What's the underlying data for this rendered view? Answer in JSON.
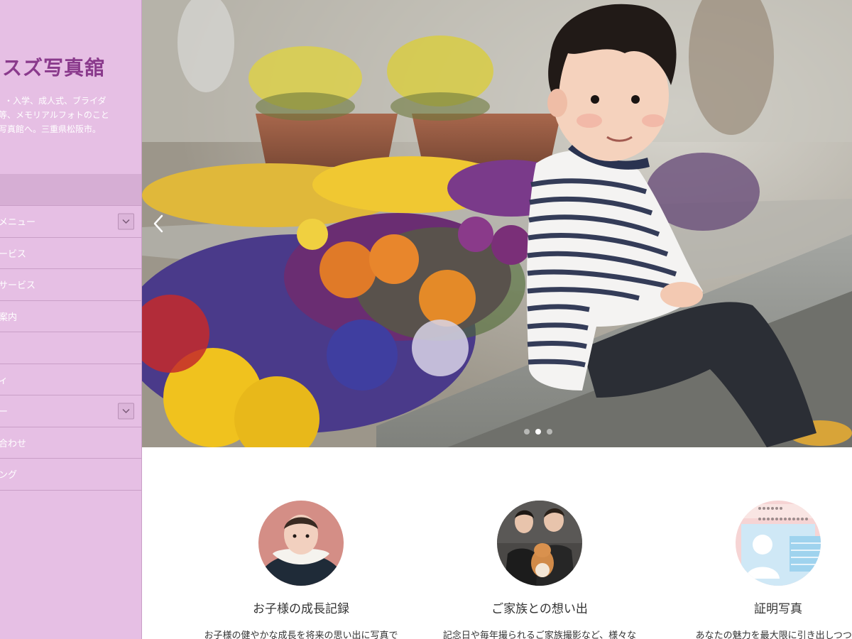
{
  "logo": {
    "text": "ミスズ写真舘"
  },
  "tagline": {
    "line1": "・入学、成人式、ブライダ",
    "line2": "等、メモリアルフォトのこと",
    "line3": "写真館へ。三重県松阪市。"
  },
  "nav": {
    "items": [
      {
        "label": "メニュー",
        "has_dropdown": true
      },
      {
        "label": "ービス",
        "has_dropdown": false
      },
      {
        "label": "サービス",
        "has_dropdown": false
      },
      {
        "label": "案内",
        "has_dropdown": false
      },
      {
        "label": "",
        "has_dropdown": false
      },
      {
        "label": "ィ",
        "has_dropdown": false
      },
      {
        "label": "ー",
        "has_dropdown": true
      },
      {
        "label": "合わせ",
        "has_dropdown": false
      },
      {
        "label": "ング",
        "has_dropdown": false
      }
    ]
  },
  "hero": {
    "slide_count": 3,
    "active_slide": 2,
    "prev_icon": "chevron-left-icon"
  },
  "services": [
    {
      "title": "お子様の成長記録",
      "text": "お子様の健やかな成長を将来の思い出に写真で",
      "icon": "baby-portrait"
    },
    {
      "title": "ご家族との想い出",
      "text": "記念日や毎年撮られるご家族撮影など、様々な",
      "icon": "family-with-dog-portrait"
    },
    {
      "title": "証明写真",
      "text": "あなたの魅力を最大限に引き出しつつ、",
      "icon": "id-card-icon"
    }
  ],
  "colors": {
    "sidebar_bg": "#e6bfe4",
    "logo": "#8a3a8c",
    "nav_text": "#ffffff"
  }
}
